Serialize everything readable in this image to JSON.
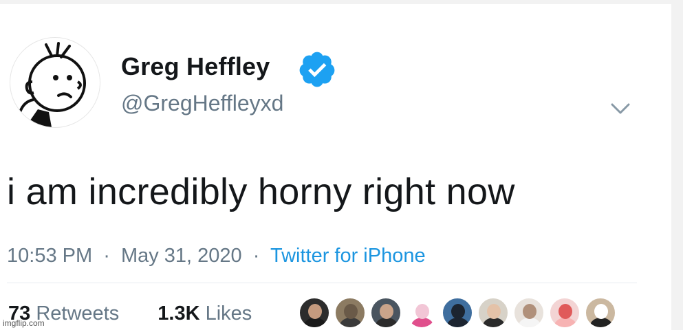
{
  "tweet": {
    "display_name": "Greg Heffley",
    "handle": "@GregHeffleyxd",
    "text": "i am incredibly horny right now",
    "time": "10:53 PM",
    "separator": "·",
    "date": "May 31, 2020",
    "source": "Twitter for iPhone",
    "retweets_count": "73",
    "retweets_label": "Retweets",
    "likes_count": "1.3K",
    "likes_label": "Likes"
  },
  "icons": {
    "verified": "verified-badge-icon",
    "menu": "chevron-down-icon"
  },
  "liker_avatars": [
    {
      "bg": "#2c2c2c",
      "head": "#c49a7e",
      "body": "#1a1a1a"
    },
    {
      "bg": "#8c7b62",
      "head": "#6a5a48",
      "body": "#3a3a3a"
    },
    {
      "bg": "#4a5560",
      "head": "#caa48a",
      "body": "#2b2b2b"
    },
    {
      "bg": "#ffffff",
      "head": "#f2c6d6",
      "body": "#e04f8c"
    },
    {
      "bg": "#3f6e9e",
      "head": "#1c2430",
      "body": "#1c2430"
    },
    {
      "bg": "#d7d2c8",
      "head": "#e4c2a8",
      "body": "#2a2a2a"
    },
    {
      "bg": "#e8e2dc",
      "head": "#b0907a",
      "body": "#f5f5f5"
    },
    {
      "bg": "#f3d4d4",
      "head": "#e05a5a",
      "body": "#f7b3b3"
    },
    {
      "bg": "#cbb8a0",
      "head": "#ffffff",
      "body": "#222222"
    }
  ],
  "colors": {
    "text_primary": "#14171a",
    "text_secondary": "#657786",
    "link": "#1b95e0",
    "verified": "#1da1f2"
  },
  "watermark": "imgflip.com"
}
